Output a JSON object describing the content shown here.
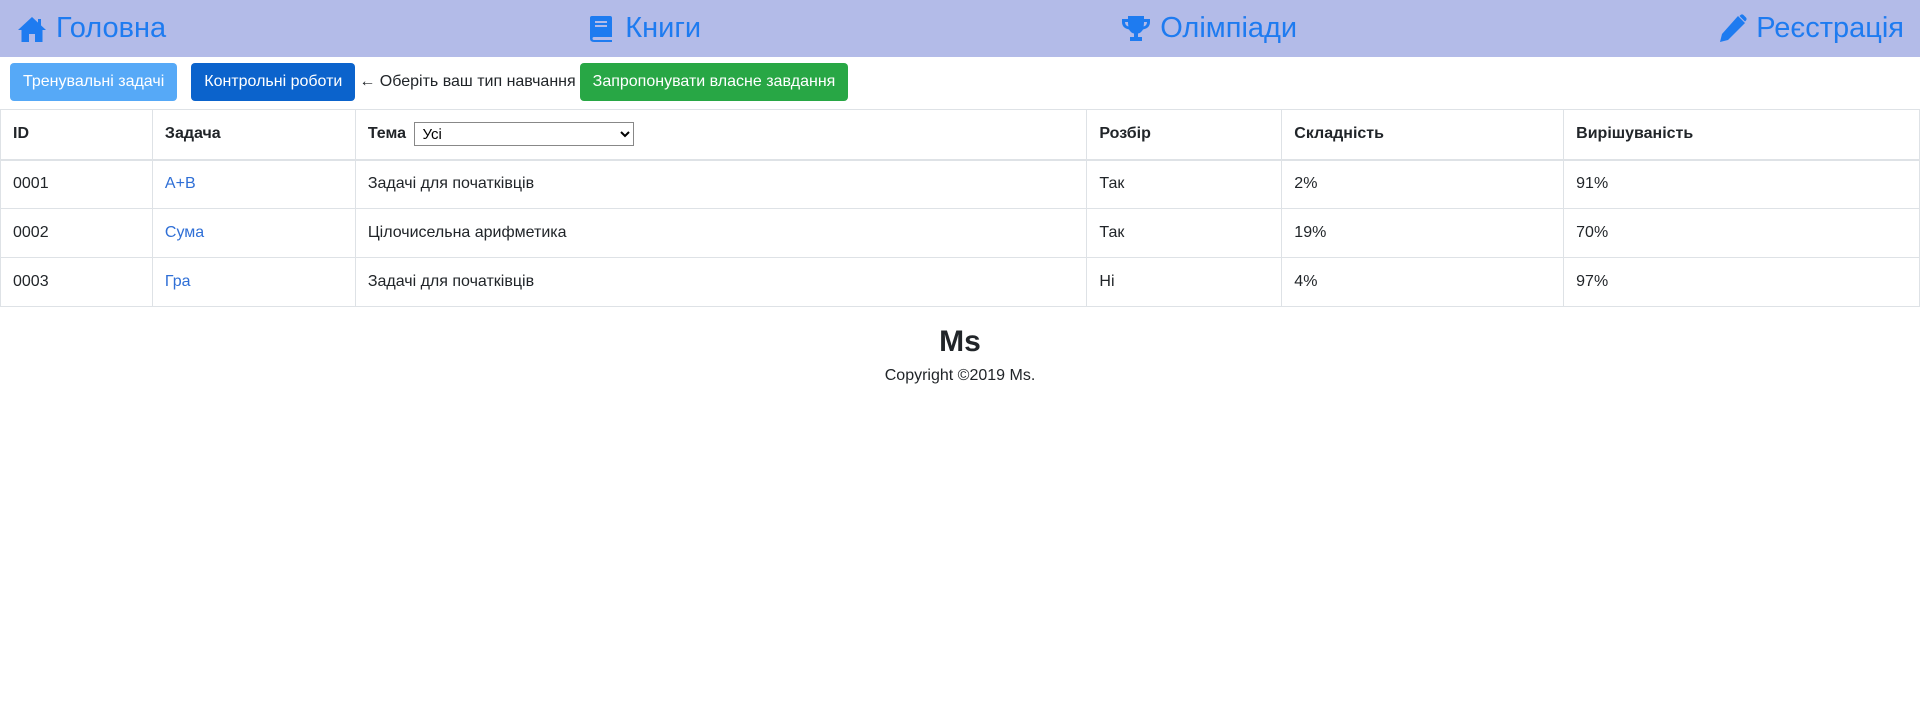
{
  "nav": {
    "home": "Головна",
    "books": "Книги",
    "olympiads": "Олімпіади",
    "register": "Реєстрація",
    "accent_color": "#1e7bf0",
    "bar_color": "#b3bbe8"
  },
  "toolbar": {
    "training_label": "Тренувальні задачі",
    "control_label": "Контрольні роботи",
    "hint": "← Оберіть ваш тип навчання",
    "propose_label": "Запропонувати власне завдання"
  },
  "table": {
    "headers": {
      "id": "ID",
      "task": "Задача",
      "topic": "Тема",
      "review": "Розбір",
      "difficulty": "Складність",
      "solved": "Вирішуваність"
    },
    "topic_filter": {
      "selected": "Усі"
    },
    "rows": [
      {
        "id": "0001",
        "task": "A+B",
        "topic": "Задачі для початківців",
        "review": "Так",
        "difficulty": "2%",
        "solved": "91%"
      },
      {
        "id": "0002",
        "task": "Сума",
        "topic": "Цілочисельна арифметика",
        "review": "Так",
        "difficulty": "19%",
        "solved": "70%"
      },
      {
        "id": "0003",
        "task": "Гра",
        "topic": "Задачі для початківців",
        "review": "Ні",
        "difficulty": "4%",
        "solved": "97%"
      }
    ]
  },
  "footer": {
    "brand": "Ms",
    "copyright": "Copyright ©2019 Ms."
  }
}
